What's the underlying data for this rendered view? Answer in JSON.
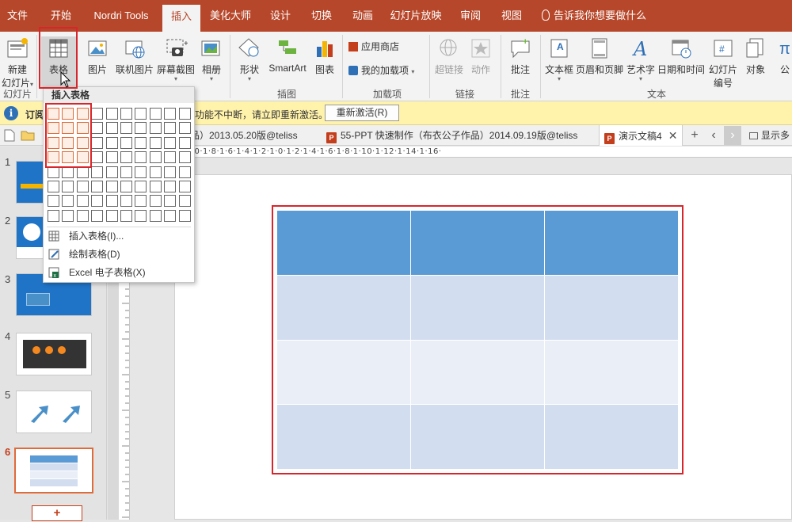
{
  "menu_tabs": [
    "文件",
    "开始",
    "Nordri Tools",
    "插入",
    "美化大师",
    "设计",
    "切换",
    "动画",
    "幻灯片放映",
    "审阅",
    "视图"
  ],
  "active_tab": "插入",
  "tell_me": "告诉我你想要做什么",
  "ribbon": {
    "new_slide": {
      "line1": "新建",
      "line2": "幻灯片"
    },
    "table": "表格",
    "picture": "图片",
    "online_picture": "联机图片",
    "screenshot": "屏幕截图",
    "album": "相册",
    "shapes": "形状",
    "smartart": "SmartArt",
    "chart": "图表",
    "app_store": "应用商店",
    "my_addins": "我的加载项",
    "hyperlink": "超链接",
    "action": "动作",
    "comment": "批注",
    "textbox": "文本框",
    "header_footer": "页眉和页脚",
    "wordart": "艺术字",
    "datetime": "日期和时间",
    "slide_number": {
      "line1": "幻灯片",
      "line2": "编号"
    },
    "object": "对象",
    "symbol_partial": "公",
    "groups": {
      "slides": "幻灯片",
      "illustrations": "插图",
      "addins": "加载项",
      "links": "链接",
      "comments": "批注",
      "text": "文本"
    }
  },
  "notification": {
    "title": "订阅",
    "message": "功能不中断，请立即重新激活。",
    "button": "重新激活(R)"
  },
  "doc_tabs": {
    "tab1": "品）2013.05.20版@teliss",
    "tab2": "55-PPT 快速制作（布衣公子作品）2014.09.19版@teliss",
    "tab3": "演示文稿4",
    "show_more": "显示多"
  },
  "ruler_text": "·5·1·14·1·12·1·10·1·8·1·6·1·4·1·2·1·0·1·2·1·4·1·6·1·8·1·10·1·12·1·14·1·16·",
  "slide_numbers": [
    "1",
    "2",
    "3",
    "4",
    "5",
    "6"
  ],
  "active_slide": "6",
  "add_slide": "+",
  "dropdown": {
    "title": "插入表格",
    "grid_cols": 10,
    "grid_rows": 8,
    "selected_cols": 3,
    "selected_rows": 4,
    "items": [
      {
        "label": "插入表格(I)..."
      },
      {
        "label": "绘制表格(D)"
      },
      {
        "label": "Excel 电子表格(X)"
      }
    ]
  },
  "slide_table": {
    "rows": 4,
    "cols": 3
  },
  "colors": {
    "accent": "#b7472a",
    "highlight_red": "#d7262b",
    "table_header": "#5b9bd5",
    "table_band1": "#d2deef",
    "table_band2": "#eaeff7"
  }
}
